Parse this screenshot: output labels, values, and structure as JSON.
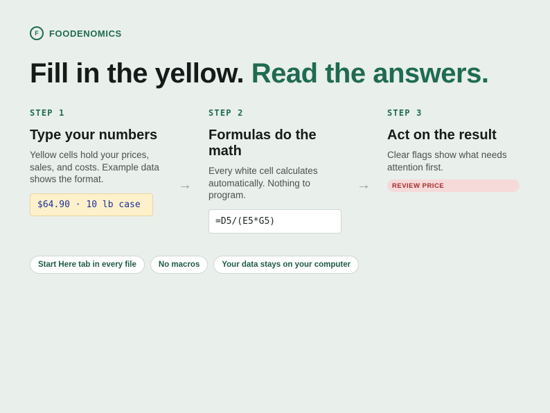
{
  "brand": {
    "mark": "F",
    "name": "FOODENOMICS"
  },
  "headline": {
    "part1": "Fill in the yellow.",
    "part2": "Read the answers."
  },
  "steps": [
    {
      "number": "STEP 1",
      "title": "Type your numbers",
      "description": "Yellow cells hold your prices, sales, and costs. Example data shows the format.",
      "example_cell": "$64.90 · 10 lb case"
    },
    {
      "number": "STEP 2",
      "title": "Formulas do the math",
      "description": "Every white cell calculates automatically. Nothing to program.",
      "formula_cell": "=D5/(E5*G5)"
    },
    {
      "number": "STEP 3",
      "title": "Act on the result",
      "description": "Clear flags show what needs attention first.",
      "flag_label": "REVIEW PRICE"
    }
  ],
  "arrow_glyph": "→",
  "pills": [
    "Start Here tab in every file",
    "No macros",
    "Your data stays on your computer"
  ],
  "colors": {
    "background": "#e9efeb",
    "accent_green": "#1f6b52",
    "input_yellow": "#fdf1cc",
    "flag_red": "#a32a2a",
    "flag_bg": "#f6dada"
  }
}
